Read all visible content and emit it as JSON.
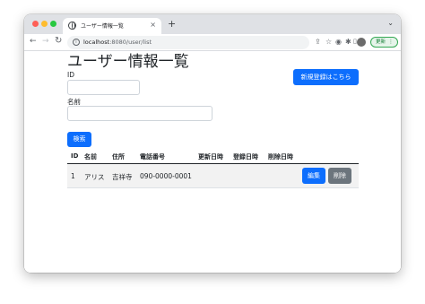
{
  "browser": {
    "tab_title": "ユーザー情報一覧",
    "tab_close": "×",
    "new_tab": "+",
    "tab_search": "⌄",
    "url_host": "localhost",
    "url_rest": ":8080/user/list",
    "update_label": "更新",
    "update_dots": "⋮",
    "icons": [
      "site-info-icon",
      "share-icon",
      "bookmark-star-icon",
      "extension-icon",
      "puzzle-icon",
      "sidepanel-icon",
      "profile-avatar-icon"
    ]
  },
  "page": {
    "title": "ユーザー情報一覧",
    "new_register_label": "新規登録はこちら",
    "form": {
      "id_label": "ID",
      "id_value": "",
      "name_label": "名前",
      "name_value": "",
      "search_label": "検索"
    },
    "table": {
      "headers": [
        "ID",
        "名前",
        "住所",
        "電話番号",
        "更新日時",
        "登録日時",
        "削除日時"
      ],
      "rows": [
        {
          "id": "1",
          "name": "アリス",
          "address": "吉祥寺",
          "phone": "090-0000-0001",
          "updated": "",
          "registered": "",
          "deleted": "",
          "edit_label": "編集",
          "delete_label": "削除"
        }
      ]
    }
  },
  "colors": {
    "primary": "#0d6efd",
    "secondary": "#6c757d",
    "update_green": "#188038"
  }
}
